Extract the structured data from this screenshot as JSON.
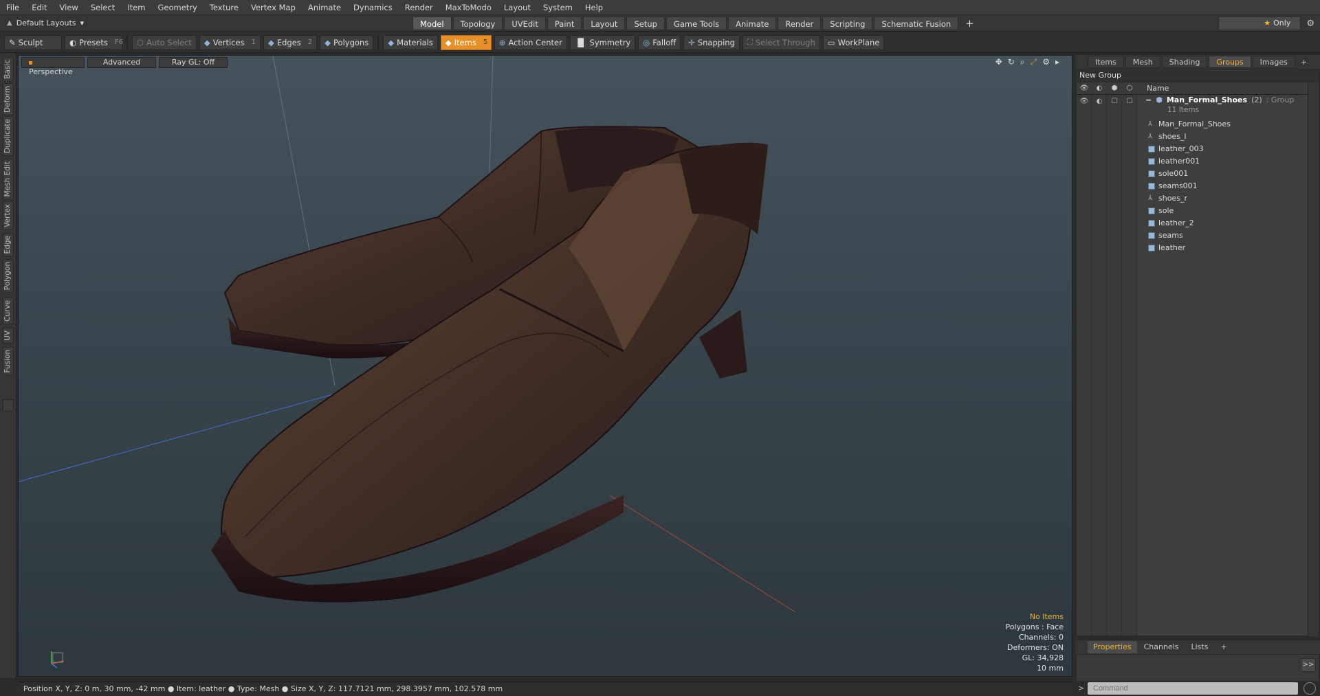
{
  "menu": [
    "File",
    "Edit",
    "View",
    "Select",
    "Item",
    "Geometry",
    "Texture",
    "Vertex Map",
    "Animate",
    "Dynamics",
    "Render",
    "MaxToModo",
    "Layout",
    "System",
    "Help"
  ],
  "layout_dropdown": "Default Layouts",
  "mode_tabs": [
    "Model",
    "Topology",
    "UVEdit",
    "Paint",
    "Layout",
    "Setup",
    "Game Tools",
    "Animate",
    "Render",
    "Scripting",
    "Schematic Fusion"
  ],
  "active_mode_tab": "Model",
  "only_button": "Only",
  "toolbar": {
    "sculpt": "Sculpt",
    "presets": "Presets",
    "presets_key": "F6",
    "auto_select": "Auto Select",
    "vertices": "Vertices",
    "vertices_key": "1",
    "edges": "Edges",
    "edges_key": "2",
    "polygons": "Polygons",
    "materials": "Materials",
    "items": "Items",
    "items_key": "5",
    "action_center": "Action Center",
    "symmetry": "Symmetry",
    "falloff": "Falloff",
    "snapping": "Snapping",
    "select_through": "Select Through",
    "workplane": "WorkPlane"
  },
  "left_tabs": [
    "Basic",
    "Deform",
    "Duplicate",
    "Mesh Edit",
    "Vertex",
    "Edge",
    "Polygon",
    "Curve",
    "UV",
    "Fusion"
  ],
  "viewport": {
    "view_mode": "Perspective",
    "shading": "Advanced",
    "raygl": "Ray GL: Off",
    "info": {
      "no_items": "No Items",
      "polygons": "Polygons : Face",
      "channels": "Channels: 0",
      "deformers": "Deformers: ON",
      "gl": "GL: 34,928",
      "grid": "10 mm"
    }
  },
  "status_bar": "Position X, Y, Z:   0 m, 30 mm, -42 mm ● Item:  leather ● Type:  Mesh ● Size X, Y, Z:   117.7121 mm, 298.3957 mm, 102.578 mm",
  "right_panel": {
    "tabs": [
      "Items",
      "Mesh ...",
      "Shading",
      "Groups",
      "Images"
    ],
    "active_tab": "Groups",
    "new_group": "New Group",
    "column_name": "Name",
    "group": {
      "name": "Man_Formal_Shoes",
      "count": "(2)",
      "type": ": Group",
      "subtitle": "11 Items"
    },
    "items": [
      {
        "name": "Man_Formal_Shoes",
        "kind": "locator"
      },
      {
        "name": "shoes_l",
        "kind": "locator"
      },
      {
        "name": "leather_003",
        "kind": "mesh"
      },
      {
        "name": "leather001",
        "kind": "mesh"
      },
      {
        "name": "sole001",
        "kind": "mesh"
      },
      {
        "name": "seams001",
        "kind": "mesh"
      },
      {
        "name": "shoes_r",
        "kind": "locator"
      },
      {
        "name": "sole",
        "kind": "mesh"
      },
      {
        "name": "leather_2",
        "kind": "mesh"
      },
      {
        "name": "seams",
        "kind": "mesh"
      },
      {
        "name": "leather",
        "kind": "mesh"
      }
    ]
  },
  "bottom_panel": {
    "tabs": [
      "Properties",
      "Channels",
      "Lists"
    ],
    "active_tab": "Properties"
  },
  "command_placeholder": "Command"
}
